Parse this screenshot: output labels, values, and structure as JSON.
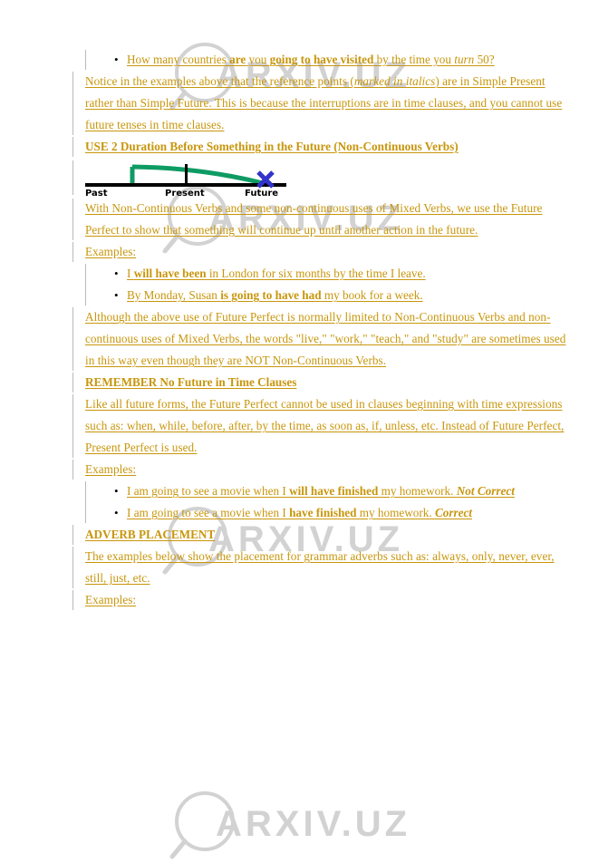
{
  "colors": {
    "text": "#c8960c",
    "changebar": "#b9b9b9",
    "bullet": "#000000",
    "timeline_axis": "#000000",
    "timeline_curve": "#0e9b64",
    "timeline_marker": "#3333cc",
    "watermark": "#d2d2d2",
    "background": "#ffffff"
  },
  "watermark": {
    "text": "ARXIV.UZ",
    "icon": "magnifier-icon",
    "count": 4
  },
  "blocks": [
    {
      "id": "bullet-list-1",
      "type": "list",
      "items": [
        {
          "runs": [
            {
              "t": "How many countries ",
              "b": false,
              "i": false
            },
            {
              "t": "are",
              "b": true,
              "i": false
            },
            {
              "t": " you ",
              "b": false,
              "i": false
            },
            {
              "t": "going to have visited",
              "b": true,
              "i": false
            },
            {
              "t": " by the time you ",
              "b": false,
              "i": false
            },
            {
              "t": "turn",
              "b": false,
              "i": true
            },
            {
              "t": " 50?",
              "b": false,
              "i": false
            }
          ],
          "plain": "How many countries are you going to have visited by the time you turn 50?"
        }
      ]
    },
    {
      "id": "paragraph-notice",
      "type": "paragraph",
      "runs": [
        {
          "t": "Notice in the examples above that the reference points (",
          "b": false,
          "i": false
        },
        {
          "t": "marked in italics",
          "b": false,
          "i": true
        },
        {
          "t": ") are in Simple Present rather than Simple Future. This is because the interruptions are in time clauses, and you cannot use future tenses in time clauses.",
          "b": false,
          "i": false
        }
      ],
      "plain": "Notice in the examples above that the reference points (marked in italics) are in Simple Present rather than Simple Future. This is because the interruptions are in time clauses, and you cannot use future tenses in time clauses."
    },
    {
      "id": "heading-use-2",
      "type": "heading",
      "text": "USE 2 Duration Before Something in the Future (Non-Continuous Verbs)"
    },
    {
      "id": "timeline-figure",
      "type": "figure",
      "labels": [
        "Past",
        "Present",
        "Future"
      ],
      "marker": "X"
    },
    {
      "id": "paragraph-non-continuous",
      "type": "paragraph",
      "plain": "With Non-Continuous Verbs and some non-continuous uses of Mixed Verbs, we use the Future Perfect to show that something will continue up until another action in the future.",
      "runs": [
        {
          "t": "With Non-Continuous Verbs and some non-continuous uses of Mixed Verbs, we use the Future Perfect to show that something will continue up until another action in the future.",
          "b": false,
          "i": false
        }
      ]
    },
    {
      "id": "label-examples-1",
      "type": "paragraph",
      "plain": "Examples:",
      "runs": [
        {
          "t": "Examples:",
          "b": false,
          "i": false
        }
      ]
    },
    {
      "id": "bullet-list-2",
      "type": "list",
      "items": [
        {
          "plain": "I will have been in London for six months by the time I leave.",
          "runs": [
            {
              "t": "I ",
              "b": false,
              "i": false
            },
            {
              "t": "will have been",
              "b": true,
              "i": false
            },
            {
              "t": " in London for six months by the time I leave.",
              "b": false,
              "i": false
            }
          ]
        },
        {
          "plain": "By Monday, Susan is going to have had my book for a week.",
          "runs": [
            {
              "t": "By Monday, Susan ",
              "b": false,
              "i": false
            },
            {
              "t": "is going to have had",
              "b": true,
              "i": false
            },
            {
              "t": " my book for a week.",
              "b": false,
              "i": false
            }
          ]
        }
      ]
    },
    {
      "id": "paragraph-although",
      "type": "paragraph",
      "plain": "Although the above use of Future Perfect is normally limited to Non-Continuous Verbs and non-continuous uses of Mixed Verbs, the words \"live,\" \"work,\" \"teach,\" and \"study\" are sometimes used in this way even though they are NOT Non-Continuous Verbs.",
      "runs": [
        {
          "t": "Although the above use of Future Perfect is normally limited to Non-Continuous Verbs and non-continuous uses of Mixed Verbs, the words \"live,\" \"work,\" \"teach,\" and \"study\" are sometimes used in this way even though they are NOT Non-Continuous Verbs.",
          "b": false,
          "i": false
        }
      ]
    },
    {
      "id": "heading-remember",
      "type": "heading",
      "text": "REMEMBER No Future in Time Clauses"
    },
    {
      "id": "paragraph-like-all",
      "type": "paragraph",
      "plain": "Like all future forms, the Future Perfect cannot be used in clauses beginning with time expressions such as: when, while, before, after, by the time, as soon as, if, unless, etc. Instead of Future Perfect, Present Perfect is used.",
      "runs": [
        {
          "t": "Like all future forms, the Future Perfect cannot be used in clauses beginning with time expressions such as: when, while, before, after, by the time, as soon as, if, unless, etc. Instead of Future Perfect, Present Perfect is used.",
          "b": false,
          "i": false
        }
      ]
    },
    {
      "id": "label-examples-2",
      "type": "paragraph",
      "plain": "Examples:",
      "runs": [
        {
          "t": "Examples:",
          "b": false,
          "i": false
        }
      ]
    },
    {
      "id": "bullet-list-3",
      "type": "list",
      "items": [
        {
          "plain": "I am going to see a movie when I will have finished my homework. Not Correct",
          "runs": [
            {
              "t": "I am going to see a movie when I ",
              "b": false,
              "i": false
            },
            {
              "t": "will have finished",
              "b": true,
              "i": false
            },
            {
              "t": " my homework. ",
              "b": false,
              "i": false
            },
            {
              "t": "Not Correct",
              "b": true,
              "i": true
            }
          ]
        },
        {
          "plain": "I am going to see a movie when I have finished my homework. Correct",
          "runs": [
            {
              "t": "I am going to see a movie when I ",
              "b": false,
              "i": false
            },
            {
              "t": "have finished",
              "b": true,
              "i": false
            },
            {
              "t": " my homework. ",
              "b": false,
              "i": false
            },
            {
              "t": "Correct",
              "b": true,
              "i": true
            }
          ]
        }
      ]
    },
    {
      "id": "heading-adverb-placement",
      "type": "heading",
      "text": "ADVERB PLACEMENT"
    },
    {
      "id": "paragraph-adverbs",
      "type": "paragraph",
      "plain": "The examples below show the placement for grammar adverbs such as: always, only, never, ever, still, just, etc.",
      "runs": [
        {
          "t": "The examples below show the placement for grammar adverbs such as: always, only, never, ever, still, just, etc.",
          "b": false,
          "i": false
        }
      ]
    },
    {
      "id": "label-examples-3",
      "type": "paragraph",
      "plain": "Examples:",
      "runs": [
        {
          "t": "Examples:",
          "b": false,
          "i": false
        }
      ]
    }
  ]
}
